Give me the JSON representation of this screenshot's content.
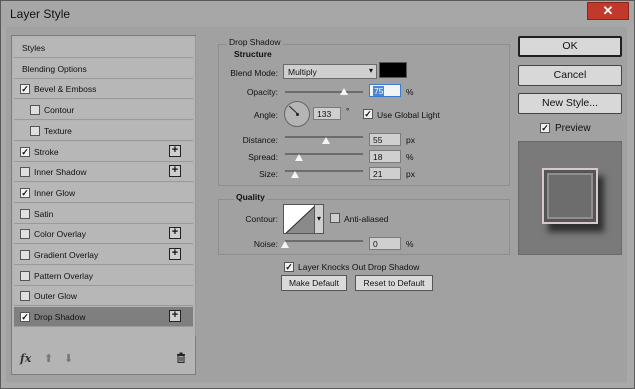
{
  "window": {
    "title": "Layer Style",
    "close_label": "✕"
  },
  "styles_panel": {
    "items": [
      {
        "label": "Styles",
        "has_checkbox": false,
        "checked": false,
        "indent": false,
        "has_plus": false,
        "active": false
      },
      {
        "label": "Blending Options",
        "has_checkbox": false,
        "checked": false,
        "indent": false,
        "has_plus": false,
        "active": false
      },
      {
        "label": "Bevel & Emboss",
        "has_checkbox": true,
        "checked": true,
        "indent": false,
        "has_plus": false,
        "active": false
      },
      {
        "label": "Contour",
        "has_checkbox": true,
        "checked": false,
        "indent": true,
        "has_plus": false,
        "active": false
      },
      {
        "label": "Texture",
        "has_checkbox": true,
        "checked": false,
        "indent": true,
        "has_plus": false,
        "active": false
      },
      {
        "label": "Stroke",
        "has_checkbox": true,
        "checked": true,
        "indent": false,
        "has_plus": true,
        "active": false
      },
      {
        "label": "Inner Shadow",
        "has_checkbox": true,
        "checked": false,
        "indent": false,
        "has_plus": true,
        "active": false
      },
      {
        "label": "Inner Glow",
        "has_checkbox": true,
        "checked": true,
        "indent": false,
        "has_plus": false,
        "active": false
      },
      {
        "label": "Satin",
        "has_checkbox": true,
        "checked": false,
        "indent": false,
        "has_plus": false,
        "active": false
      },
      {
        "label": "Color Overlay",
        "has_checkbox": true,
        "checked": false,
        "indent": false,
        "has_plus": true,
        "active": false
      },
      {
        "label": "Gradient Overlay",
        "has_checkbox": true,
        "checked": false,
        "indent": false,
        "has_plus": true,
        "active": false
      },
      {
        "label": "Pattern Overlay",
        "has_checkbox": true,
        "checked": false,
        "indent": false,
        "has_plus": false,
        "active": false
      },
      {
        "label": "Outer Glow",
        "has_checkbox": true,
        "checked": false,
        "indent": false,
        "has_plus": false,
        "active": false
      },
      {
        "label": "Drop Shadow",
        "has_checkbox": true,
        "checked": true,
        "indent": false,
        "has_plus": true,
        "active": true
      }
    ],
    "footer": {
      "fx_label": "fx",
      "up_arrow": "⬆",
      "down_arrow": "⬇",
      "trash": "🗑"
    }
  },
  "drop_shadow": {
    "group_title": "Drop Shadow",
    "structure_title": "Structure",
    "blend_mode_label": "Blend Mode:",
    "blend_mode_value": "Multiply",
    "shadow_color": "#000000",
    "opacity_label": "Opacity:",
    "opacity_value": "75",
    "opacity_unit": "%",
    "angle_label": "Angle:",
    "angle_value": "133",
    "angle_unit": "°",
    "use_global_light_label": "Use Global Light",
    "use_global_light_checked": true,
    "distance_label": "Distance:",
    "distance_value": "55",
    "distance_unit": "px",
    "spread_label": "Spread:",
    "spread_value": "18",
    "spread_unit": "%",
    "size_label": "Size:",
    "size_value": "21",
    "size_unit": "px",
    "quality_title": "Quality",
    "contour_label": "Contour:",
    "anti_aliased_label": "Anti-aliased",
    "anti_aliased_checked": false,
    "noise_label": "Noise:",
    "noise_value": "0",
    "noise_unit": "%",
    "knockout_label": "Layer Knocks Out Drop Shadow",
    "knockout_checked": true,
    "make_default_label": "Make Default",
    "reset_default_label": "Reset to Default"
  },
  "actions": {
    "ok_label": "OK",
    "cancel_label": "Cancel",
    "new_style_label": "New Style...",
    "preview_label": "Preview",
    "preview_checked": true
  }
}
